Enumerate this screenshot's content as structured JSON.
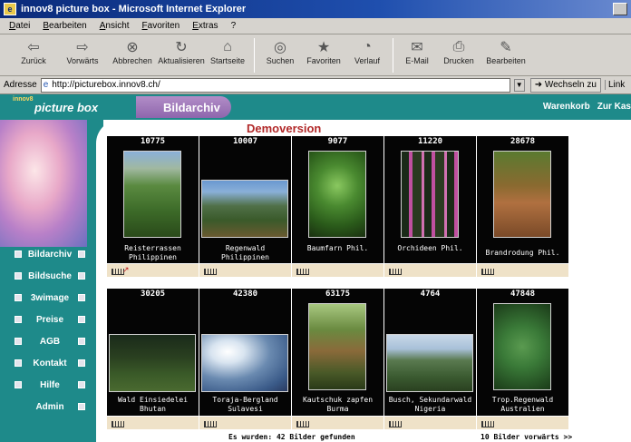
{
  "window": {
    "title": "innov8 picture box - Microsoft Internet Explorer"
  },
  "menu": [
    "Datei",
    "Bearbeiten",
    "Ansicht",
    "Favoriten",
    "Extras",
    "?"
  ],
  "toolbar": [
    {
      "label": "Zurück",
      "icon": "back-arrow-icon"
    },
    {
      "label": "Vorwärts",
      "icon": "forward-arrow-icon"
    },
    {
      "label": "Abbrechen",
      "icon": "stop-icon"
    },
    {
      "label": "Aktualisieren",
      "icon": "refresh-icon"
    },
    {
      "label": "Startseite",
      "icon": "home-icon"
    },
    {
      "label": "Suchen",
      "icon": "search-icon"
    },
    {
      "label": "Favoriten",
      "icon": "favorites-icon"
    },
    {
      "label": "Verlauf",
      "icon": "history-icon"
    },
    {
      "label": "E-Mail",
      "icon": "mail-icon"
    },
    {
      "label": "Drucken",
      "icon": "print-icon"
    },
    {
      "label": "Bearbeiten",
      "icon": "edit-icon"
    }
  ],
  "address": {
    "label": "Adresse",
    "url": "http://picturebox.innov8.ch/",
    "go": "Wechseln zu",
    "links": "Link"
  },
  "site": {
    "logo_small": "innov8",
    "logo_main": "picture box",
    "section": "Bildarchiv",
    "header_links": [
      "Warenkorb",
      "Zur Kas"
    ]
  },
  "nav": [
    "Bildarchiv",
    "Bildsuche",
    "3wimage",
    "Preise",
    "AGB",
    "Kontakt",
    "Hilfe",
    "Admin"
  ],
  "demo_title": "Demoversion",
  "gallery": [
    {
      "id": "10775",
      "caption": "Reisterrassen Philippinen"
    },
    {
      "id": "10007",
      "caption": "Regenwald Philippinen"
    },
    {
      "id": "9077",
      "caption": "Baumfarn Phil."
    },
    {
      "id": "11220",
      "caption": "Orchideen Phil."
    },
    {
      "id": "28678",
      "caption": "Brandrodung Phil."
    },
    {
      "id": "30205",
      "caption": "Wald Einsiedelei Bhutan"
    },
    {
      "id": "42380",
      "caption": "Toraja-Bergland Sulavesi"
    },
    {
      "id": "63175",
      "caption": "Kautschuk zapfen Burma"
    },
    {
      "id": "4764",
      "caption": "Busch, Sekundarwald Nigeria"
    },
    {
      "id": "47848",
      "caption": "Trop.Regenwald Australien"
    }
  ],
  "footer": {
    "found": "Es wurden: 42 Bilder gefunden",
    "next": "10 Bilder vorwärts >>"
  }
}
